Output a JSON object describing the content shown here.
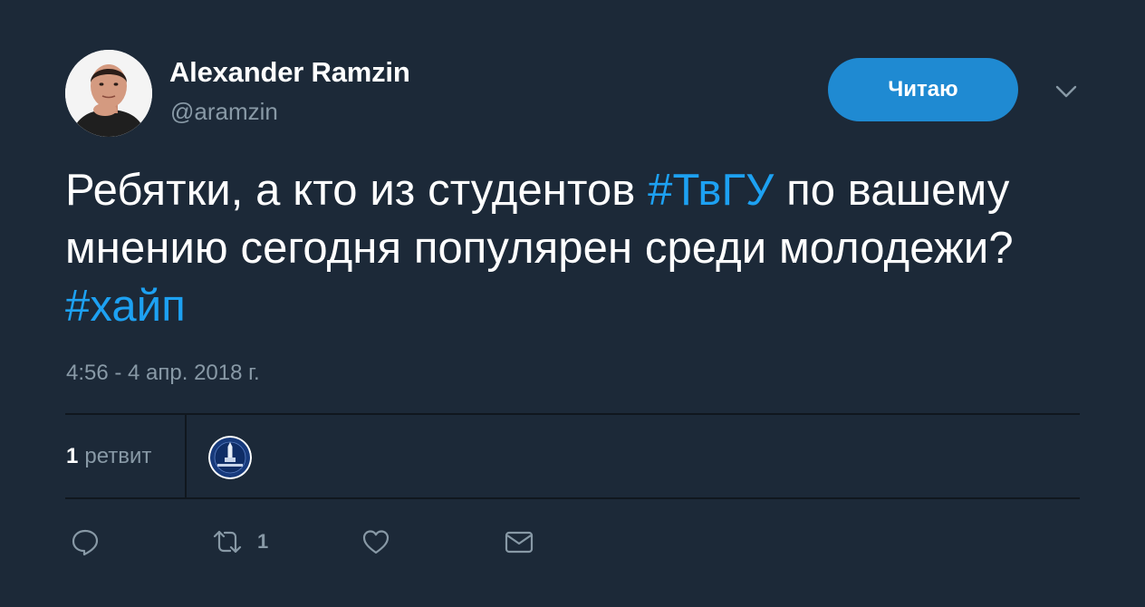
{
  "author": {
    "display_name": "Alexander Ramzin",
    "handle": "@aramzin"
  },
  "follow_button": {
    "label": "Читаю"
  },
  "tweet": {
    "text_part1": "Ребятки, а кто из студентов ",
    "hashtag1": "#ТвГУ",
    "text_part2": " по вашему мнению сегодня популярен среди молодежи? ",
    "hashtag2": "#хайп",
    "timestamp": "4:56 - 4 апр. 2018 г."
  },
  "stats": {
    "retweet_count": "1",
    "retweet_label": "ретвит"
  },
  "actions": {
    "reply_icon": "reply-icon",
    "retweet_icon": "retweet-icon",
    "retweet_count": "1",
    "like_icon": "heart-icon",
    "dm_icon": "envelope-icon"
  },
  "colors": {
    "background": "#1c2938",
    "accent": "#1da1f2",
    "button": "#1f8ad2",
    "muted": "#8899a6",
    "divider": "#10171e"
  }
}
